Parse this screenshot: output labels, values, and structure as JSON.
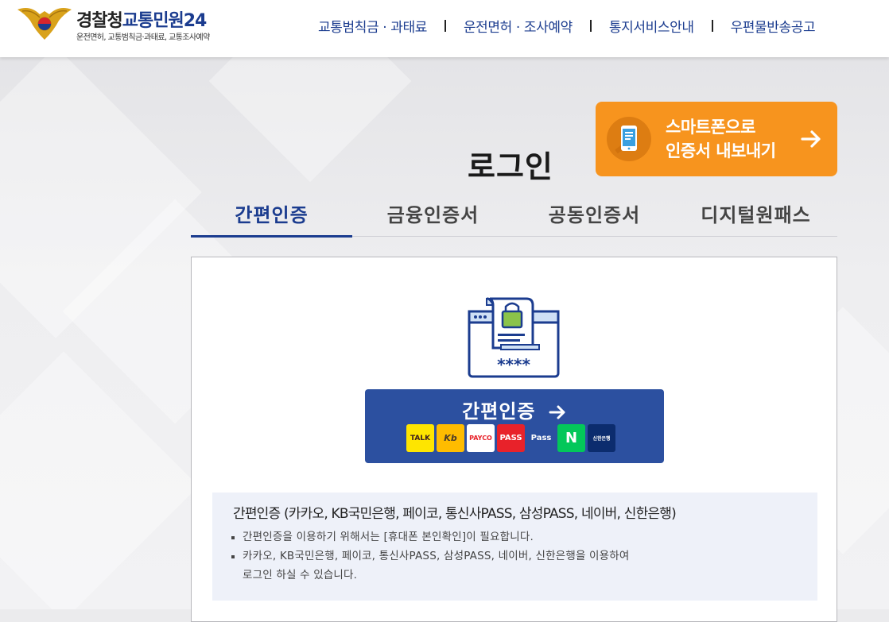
{
  "header": {
    "logo": {
      "title_main": "경찰청",
      "title_sub": "교통민원24",
      "tagline": "운전면허, 교통범칙금·과태료, 교통조사예약"
    },
    "nav": [
      {
        "label": "교통범칙금 · 과태료"
      },
      {
        "label": "운전면허 · 조사예약"
      },
      {
        "label": "통지서비스안내"
      },
      {
        "label": "우편물반송공고"
      }
    ]
  },
  "page": {
    "title": "로그인"
  },
  "smartphone_export": {
    "line1": "스마트폰으로",
    "line2": "인증서 내보내기",
    "color": "#f7941e"
  },
  "tabs": [
    {
      "label": "간편인증",
      "active": true
    },
    {
      "label": "금융인증서",
      "active": false
    },
    {
      "label": "공동인증서",
      "active": false
    },
    {
      "label": "디지털원패스",
      "active": false
    }
  ],
  "panel": {
    "illustration_code": "****",
    "simple_auth_button": {
      "label": "간편인증",
      "providers": [
        {
          "name": "kakao-talk",
          "label": "TALK",
          "bg": "#fee500",
          "fg": "#3c1e1e"
        },
        {
          "name": "kb-bank",
          "label": "Kb",
          "bg": "#ffbc00",
          "fg": "#4a3b2a"
        },
        {
          "name": "payco",
          "label": "PAYCO",
          "bg": "#ffffff",
          "fg": "#e8222a"
        },
        {
          "name": "telecom-pass",
          "label": "PASS",
          "bg": "#e8222a",
          "fg": "#ffffff"
        },
        {
          "name": "samsung-pass",
          "label": "Pass",
          "bg": "#1c4aa5",
          "fg": "#ffffff"
        },
        {
          "name": "naver",
          "label": "N",
          "bg": "#03c75a",
          "fg": "#ffffff"
        },
        {
          "name": "shinhan-bank",
          "label": "신한은행",
          "bg": "#0c2c6e",
          "fg": "#ffffff"
        }
      ]
    },
    "info": {
      "heading": "간편인증 (카카오, KB국민은행, 페이코, 통신사PASS, 삼성PASS, 네이버, 신한은행)",
      "items": [
        {
          "text": "간편인증을 이용하기 위해서는 [휴대폰 본인확인]이 필요합니다."
        },
        {
          "text": "카카오, KB국민은행, 페이코, 통신사PASS, 삼성PASS, 네이버, 신한은행을 이용하여",
          "cont": "로그인 하실 수 있습니다."
        }
      ]
    }
  },
  "colors": {
    "brand_blue": "#1b3c8f",
    "button_blue": "#2c50a0",
    "info_bg": "#eef1f9"
  }
}
